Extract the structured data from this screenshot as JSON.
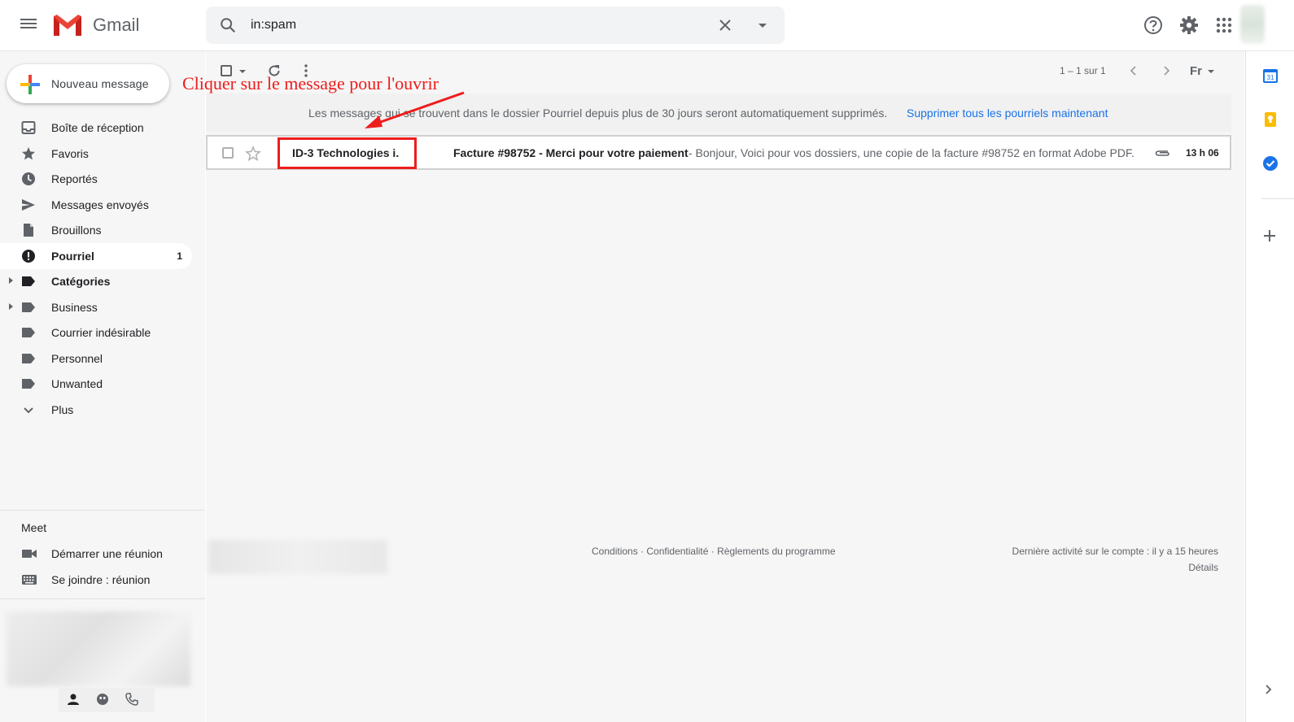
{
  "header": {
    "app_name": "Gmail",
    "search_value": "in:spam"
  },
  "compose": {
    "label": "Nouveau message"
  },
  "nav": {
    "items": [
      {
        "label": "Boîte de réception",
        "icon": "inbox-icon"
      },
      {
        "label": "Favoris",
        "icon": "star-icon"
      },
      {
        "label": "Reportés",
        "icon": "clock-icon"
      },
      {
        "label": "Messages envoyés",
        "icon": "send-icon"
      },
      {
        "label": "Brouillons",
        "icon": "draft-icon"
      },
      {
        "label": "Pourriel",
        "icon": "spam-icon",
        "count": "1",
        "active": true
      },
      {
        "label": "Catégories",
        "icon": "label-icon",
        "expandable": true
      },
      {
        "label": "Business",
        "icon": "label-icon",
        "expandable": true
      },
      {
        "label": "Courrier indésirable",
        "icon": "label-icon"
      },
      {
        "label": "Personnel",
        "icon": "label-icon"
      },
      {
        "label": "Unwanted",
        "icon": "label-icon"
      },
      {
        "label": "Plus",
        "icon": "chevron-down-icon"
      }
    ]
  },
  "meet": {
    "title": "Meet",
    "start": "Démarrer une réunion",
    "join": "Se joindre : réunion"
  },
  "toolbar": {
    "pager": "1 – 1 sur 1",
    "lang": "Fr"
  },
  "banner": {
    "text": "Les messages qui se trouvent dans le dossier Pourriel depuis plus de 30 jours seront automatiquement supprimés.",
    "link": "Supprimer tous les pourriels maintenant"
  },
  "emails": [
    {
      "sender": "ID-3 Technologies i.",
      "subject": "Facture #98752 - Merci pour votre paiement",
      "snippet": " - Bonjour, Voici pour vos dossiers, une copie de la facture #98752 en format Adobe PDF.",
      "time": "13 h 06"
    }
  ],
  "annotation": {
    "text": "Cliquer sur le message pour l'ouvrir",
    "color": "#ee1c1c"
  },
  "footer": {
    "conditions": "Conditions",
    "privacy": "Confidentialité",
    "policies": "Règlements du programme",
    "activity": "Dernière activité sur le compte : il y a 15 heures",
    "details": "Détails"
  },
  "side_panel": {
    "calendar_day": "31"
  },
  "colors": {
    "accent_blue": "#1a73e8",
    "annotation_red": "#ee1c1c"
  }
}
